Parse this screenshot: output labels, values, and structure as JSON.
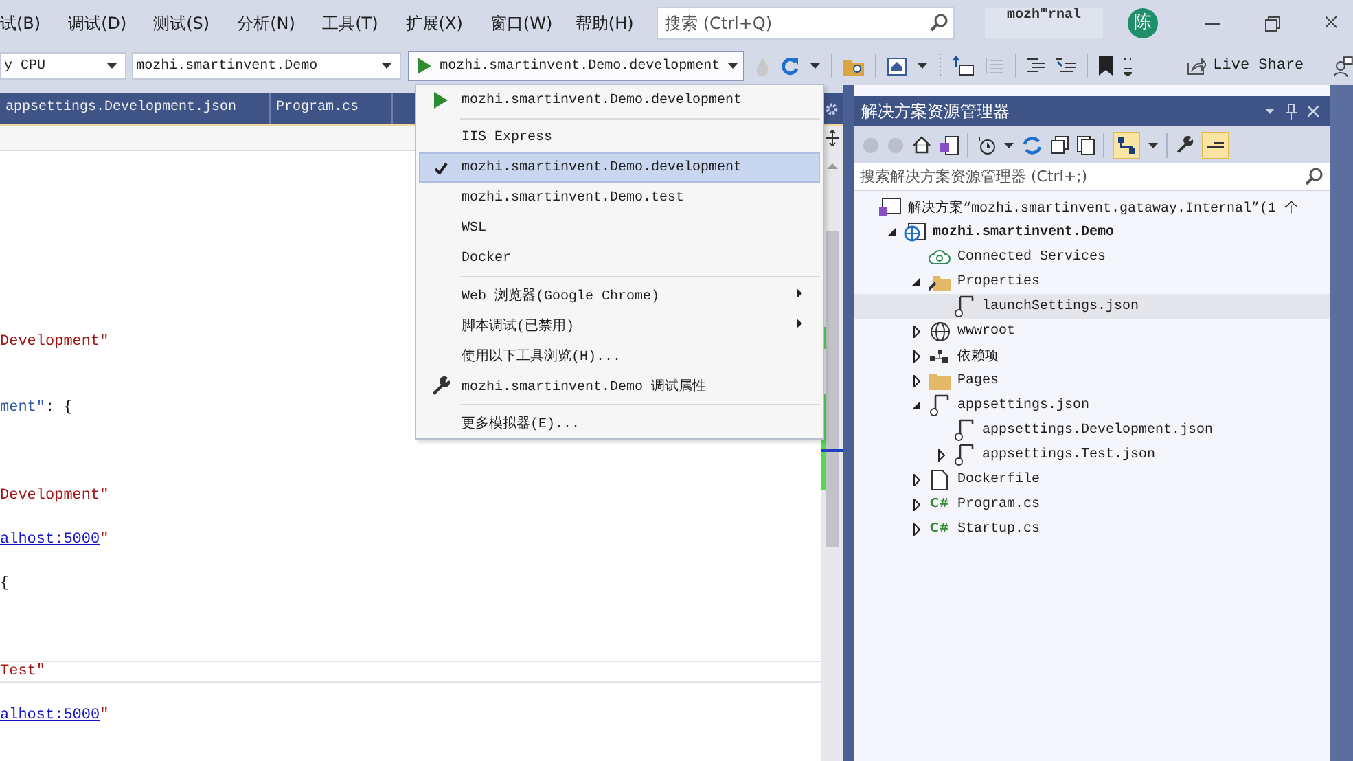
{
  "menu_bar": {
    "items": [
      "试(B)",
      "调试(D)",
      "测试(S)",
      "分析(N)",
      "工具(T)",
      "扩展(X)",
      "窗口(W)",
      "帮助(H)"
    ],
    "search": {
      "placeholder": "搜索 (Ctrl+Q)"
    },
    "solution_name": "mozh‴rnal",
    "avatar": "陈"
  },
  "toolbar": {
    "platform": "y CPU",
    "project": "mozhi.smartinvent.Demo",
    "launch_profile": "mozhi.smartinvent.Demo.development",
    "live_share": "Live Share"
  },
  "editor": {
    "tabs": [
      "appsettings.Development.json",
      "Program.cs"
    ],
    "code_lines": [
      {
        "current": false,
        "segments": [
          {
            "kind": "string",
            "text": "Development\""
          }
        ]
      },
      {
        "current": false,
        "segments": [
          {
            "kind": "key",
            "text": "ment\""
          },
          {
            "kind": "punct",
            "text": ": {"
          }
        ]
      },
      {
        "current": false,
        "segments": [
          {
            "kind": "string",
            "text": "Development\""
          }
        ]
      },
      {
        "current": false,
        "segments": [
          {
            "kind": "link",
            "text": "alhost:5000"
          },
          {
            "kind": "string",
            "text": "\""
          }
        ]
      },
      {
        "current": false,
        "segments": [
          {
            "kind": "punct",
            "text": "{"
          }
        ]
      },
      {
        "current": true,
        "segments": [
          {
            "kind": "string",
            "text": "Test\""
          }
        ]
      },
      {
        "current": false,
        "segments": [
          {
            "kind": "link",
            "text": "alhost:5000"
          },
          {
            "kind": "string",
            "text": "\""
          }
        ]
      }
    ]
  },
  "launch_menu": {
    "groups": [
      {
        "items": [
          {
            "kind": "run",
            "label": "mozhi.smartinvent.Demo.development",
            "selected": false,
            "checked": false,
            "submenu": false
          }
        ]
      },
      {
        "items": [
          {
            "kind": "profile",
            "label": "IIS Express",
            "selected": false,
            "checked": false,
            "submenu": false
          },
          {
            "kind": "profile",
            "label": "mozhi.smartinvent.Demo.development",
            "selected": true,
            "checked": true,
            "submenu": false
          },
          {
            "kind": "profile",
            "label": "mozhi.smartinvent.Demo.test",
            "selected": false,
            "checked": false,
            "submenu": false
          },
          {
            "kind": "profile",
            "label": "WSL",
            "selected": false,
            "checked": false,
            "submenu": false
          },
          {
            "kind": "profile",
            "label": "Docker",
            "selected": false,
            "checked": false,
            "submenu": false
          }
        ]
      },
      {
        "items": [
          {
            "kind": "command",
            "label": "Web 浏览器(Google Chrome)",
            "selected": false,
            "checked": false,
            "submenu": true
          },
          {
            "kind": "command",
            "label": "脚本调试(已禁用)",
            "selected": false,
            "checked": false,
            "submenu": true
          },
          {
            "kind": "command",
            "label": "使用以下工具浏览(H)...",
            "selected": false,
            "checked": false,
            "submenu": false
          },
          {
            "kind": "settings",
            "label": "mozhi.smartinvent.Demo 调试属性",
            "selected": false,
            "checked": false,
            "submenu": false
          }
        ]
      },
      {
        "items": [
          {
            "kind": "command",
            "label": "更多模拟器(E)...",
            "selected": false,
            "checked": false,
            "submenu": false
          }
        ]
      }
    ]
  },
  "solution_explorer": {
    "title": "解决方案资源管理器",
    "search": {
      "placeholder": "搜索解决方案资源管理器 (Ctrl+;)"
    },
    "tree": [
      {
        "kind": "solution",
        "label": "解决方案“mozhi.smartinvent.gataway.Internal”(1 个",
        "selected": false,
        "children": [
          {
            "kind": "project",
            "label": "mozhi.smartinvent.Demo",
            "expanded": true,
            "selected": false,
            "children": [
              {
                "kind": "service",
                "label": "Connected Services",
                "selected": false
              },
              {
                "kind": "properties",
                "label": "Properties",
                "expanded": true,
                "selected": false,
                "children": [
                  {
                    "kind": "json",
                    "label": "launchSettings.json",
                    "selected": true
                  }
                ]
              },
              {
                "kind": "web",
                "label": "wwwroot",
                "expanded": false,
                "selected": false
              },
              {
                "kind": "dependencies",
                "label": "依赖项",
                "expanded": false,
                "selected": false
              },
              {
                "kind": "folder",
                "label": "Pages",
                "expanded": false,
                "selected": false
              },
              {
                "kind": "json",
                "label": "appsettings.json",
                "expanded": true,
                "selected": false,
                "children": [
                  {
                    "kind": "json",
                    "label": "appsettings.Development.json",
                    "selected": false
                  },
                  {
                    "kind": "json",
                    "label": "appsettings.Test.json",
                    "expanded": false,
                    "selected": false
                  }
                ]
              },
              {
                "kind": "file",
                "label": "Dockerfile",
                "expanded": false,
                "selected": false
              },
              {
                "kind": "csharp",
                "icon_text": "C#",
                "label": "Program.cs",
                "expanded": false,
                "selected": false
              },
              {
                "kind": "csharp",
                "icon_text": "C#",
                "label": "Startup.cs",
                "expanded": false,
                "selected": false
              }
            ]
          }
        ]
      }
    ]
  }
}
